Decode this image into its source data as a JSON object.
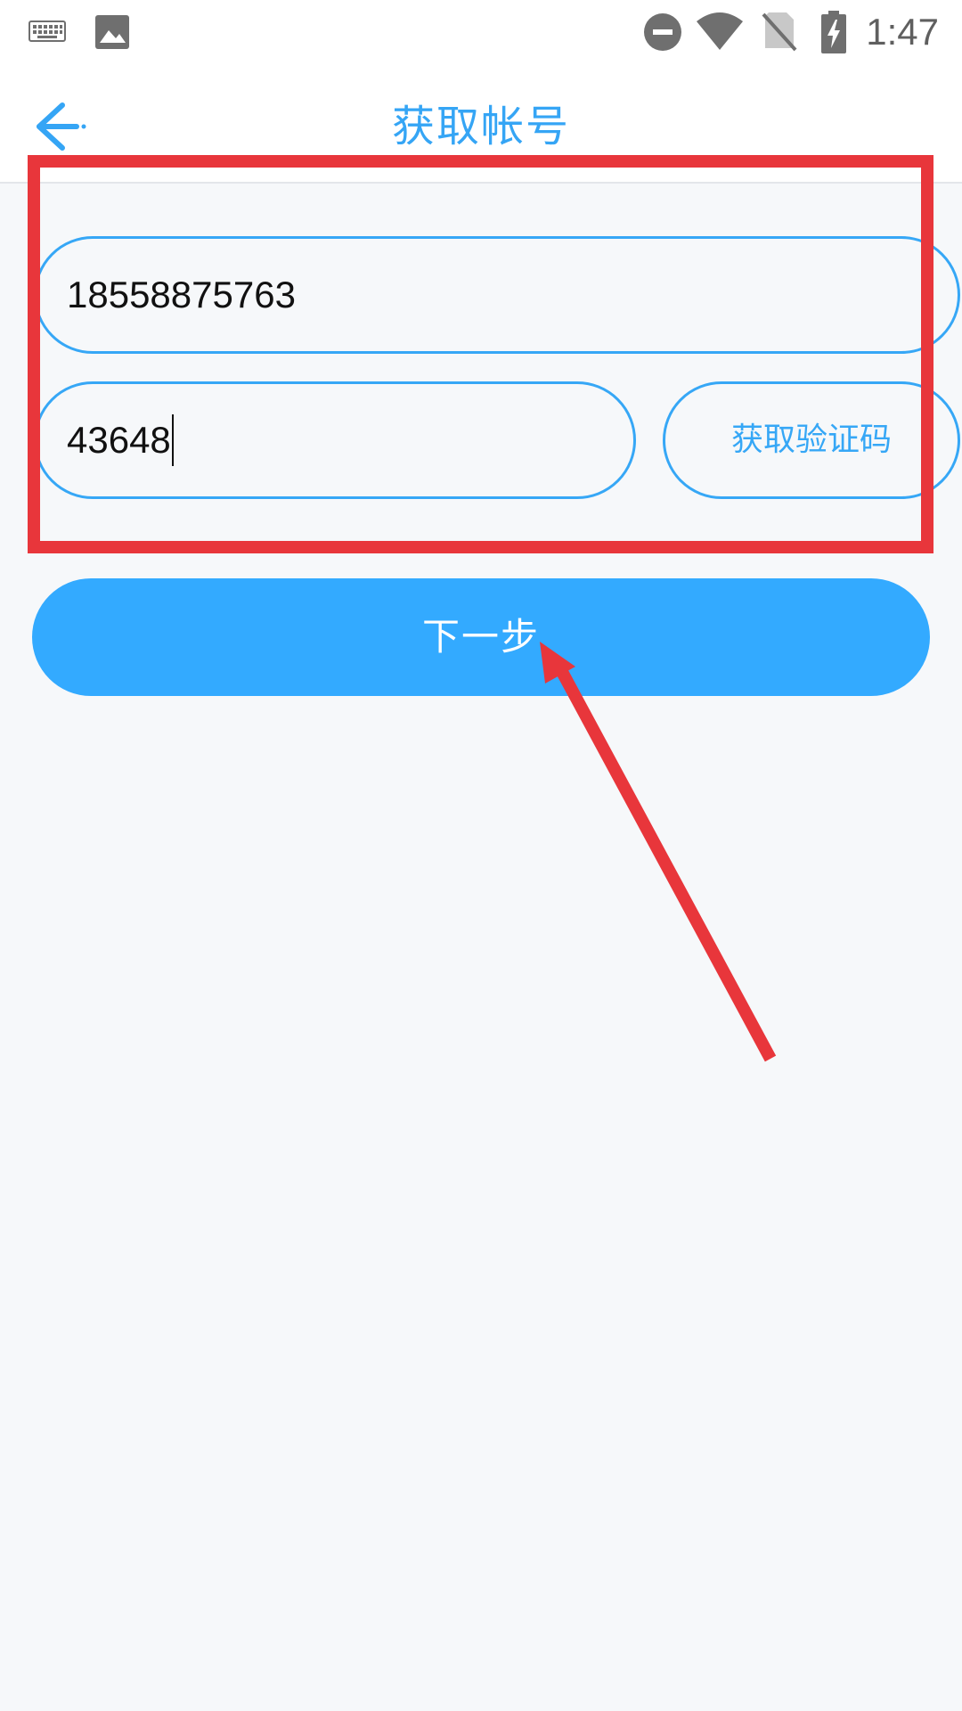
{
  "status_bar": {
    "time": "1:47",
    "icons": [
      "keyboard-icon",
      "image-icon",
      "do-not-disturb-icon",
      "wifi-icon",
      "no-sim-icon",
      "battery-charging-icon"
    ]
  },
  "header": {
    "title": "获取帐号",
    "back_icon": "arrow-left-icon"
  },
  "form": {
    "phone": {
      "value": "18558875763"
    },
    "code": {
      "value": "43648"
    },
    "get_code_label": "获取验证码"
  },
  "next_label": "下一步",
  "colors": {
    "accent": "#35a5f5",
    "button": "#33aaff",
    "annotation": "#e8363b",
    "background": "#f6f8fa"
  }
}
